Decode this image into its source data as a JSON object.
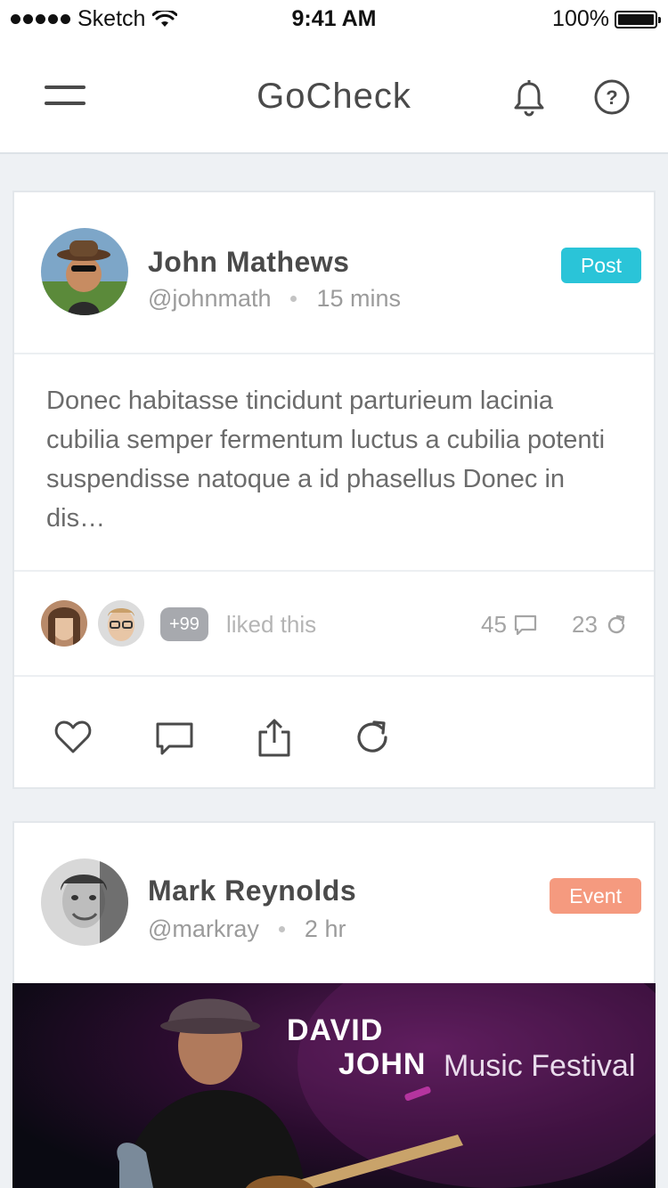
{
  "status_bar": {
    "carrier": "Sketch",
    "time": "9:41 AM",
    "battery": "100%"
  },
  "nav": {
    "title": "GoCheck",
    "icons": [
      "menu-icon",
      "bell-icon",
      "help-icon"
    ]
  },
  "posts": [
    {
      "author_name": "John Mathews",
      "handle": "@johnmath",
      "time": "15 mins",
      "tag": "Post",
      "tag_color": "#2ac4d8",
      "body": "Donec habitasse tincidunt parturieum lacinia cubilia semper fermentum luctus a cubilia potenti suspendisse natoque a id phasellus Donec  in dis…",
      "likes_count": "+99",
      "liked_text": "liked this",
      "comments": "45",
      "reposts": "23",
      "actions": [
        "heart-icon",
        "comment-icon",
        "share-icon",
        "repost-icon"
      ]
    },
    {
      "author_name": "Mark Reynolds",
      "handle": "@markray",
      "time": "2 hr",
      "tag": "Event",
      "tag_color": "#f59a7f",
      "banner": {
        "line1": "DAVID",
        "line2": "JOHN",
        "line3": "Music Festival"
      }
    }
  ]
}
